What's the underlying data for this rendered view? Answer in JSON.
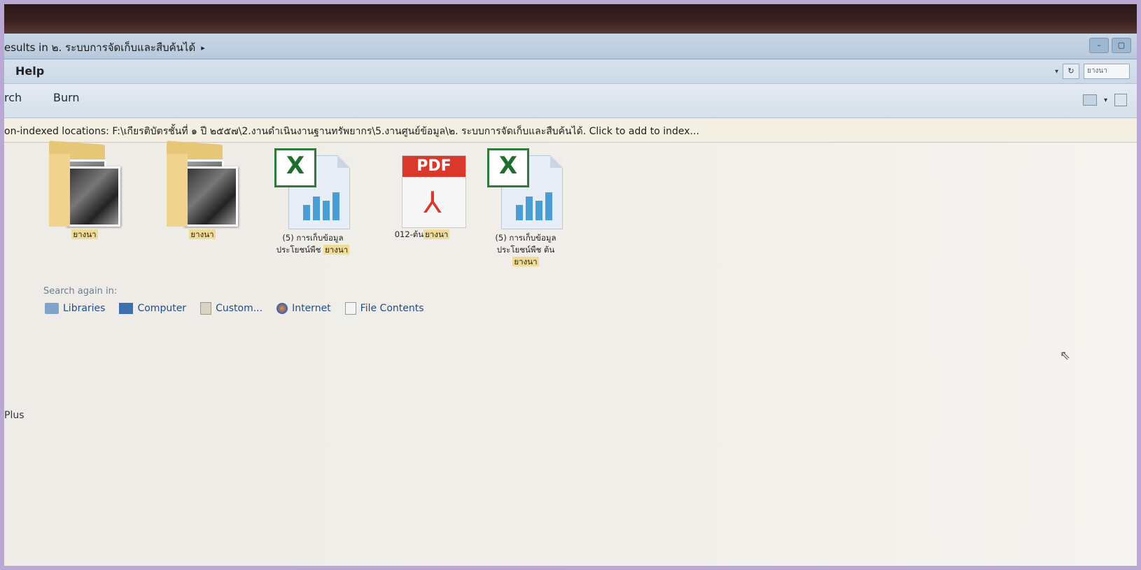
{
  "window": {
    "breadcrumb_prefix": "esults in ๒. ระบบการจัดเก็บและสืบค้นได้",
    "breadcrumb_arrow": "▸",
    "buttons": [
      "–",
      "▢"
    ]
  },
  "menu": {
    "help": "Help"
  },
  "search": {
    "refresh": "↻",
    "placeholder": "ยางนา"
  },
  "toolbar": {
    "search": "rch",
    "burn": "Burn"
  },
  "infobar": {
    "text": "on-indexed locations: F:\\เกียรติบัตรชั้นที่ ๑ ปี ๒๕๕๗\\2.งานดำเนินงานฐานทรัพยากร\\5.งานศูนย์ข้อมูล\\๒. ระบบการจัดเก็บและสืบค้นได้. Click to add to index..."
  },
  "files": [
    {
      "type": "folder",
      "label_hl": "ยางนา",
      "label_pre": ""
    },
    {
      "type": "folder",
      "label_hl": "ยางนา",
      "label_pre": ""
    },
    {
      "type": "excel",
      "line1": "(5) การเก็บข้อมูล",
      "line2_pre": "ประโยชน์พืช ",
      "line2_hl": "ยางนา"
    },
    {
      "type": "pdf",
      "label_pre": "012-ต้น",
      "label_hl": "ยางนา"
    },
    {
      "type": "excel",
      "line1": "(5) การเก็บข้อมูล",
      "line2": "ประโยชน์พืช ต้น",
      "line3_hl": "ยางนา"
    }
  ],
  "search_again": {
    "title": "Search again in:",
    "items": [
      {
        "label": "Libraries",
        "icon": "libraries-icon"
      },
      {
        "label": "Computer",
        "icon": "computer-icon"
      },
      {
        "label": "Custom...",
        "icon": "custom-icon"
      },
      {
        "label": "Internet",
        "icon": "internet-icon"
      },
      {
        "label": "File Contents",
        "icon": "file-contents-icon"
      }
    ]
  },
  "sidebar_fragment": "Plus",
  "pdf_badge": "PDF",
  "excel_badge": "X"
}
